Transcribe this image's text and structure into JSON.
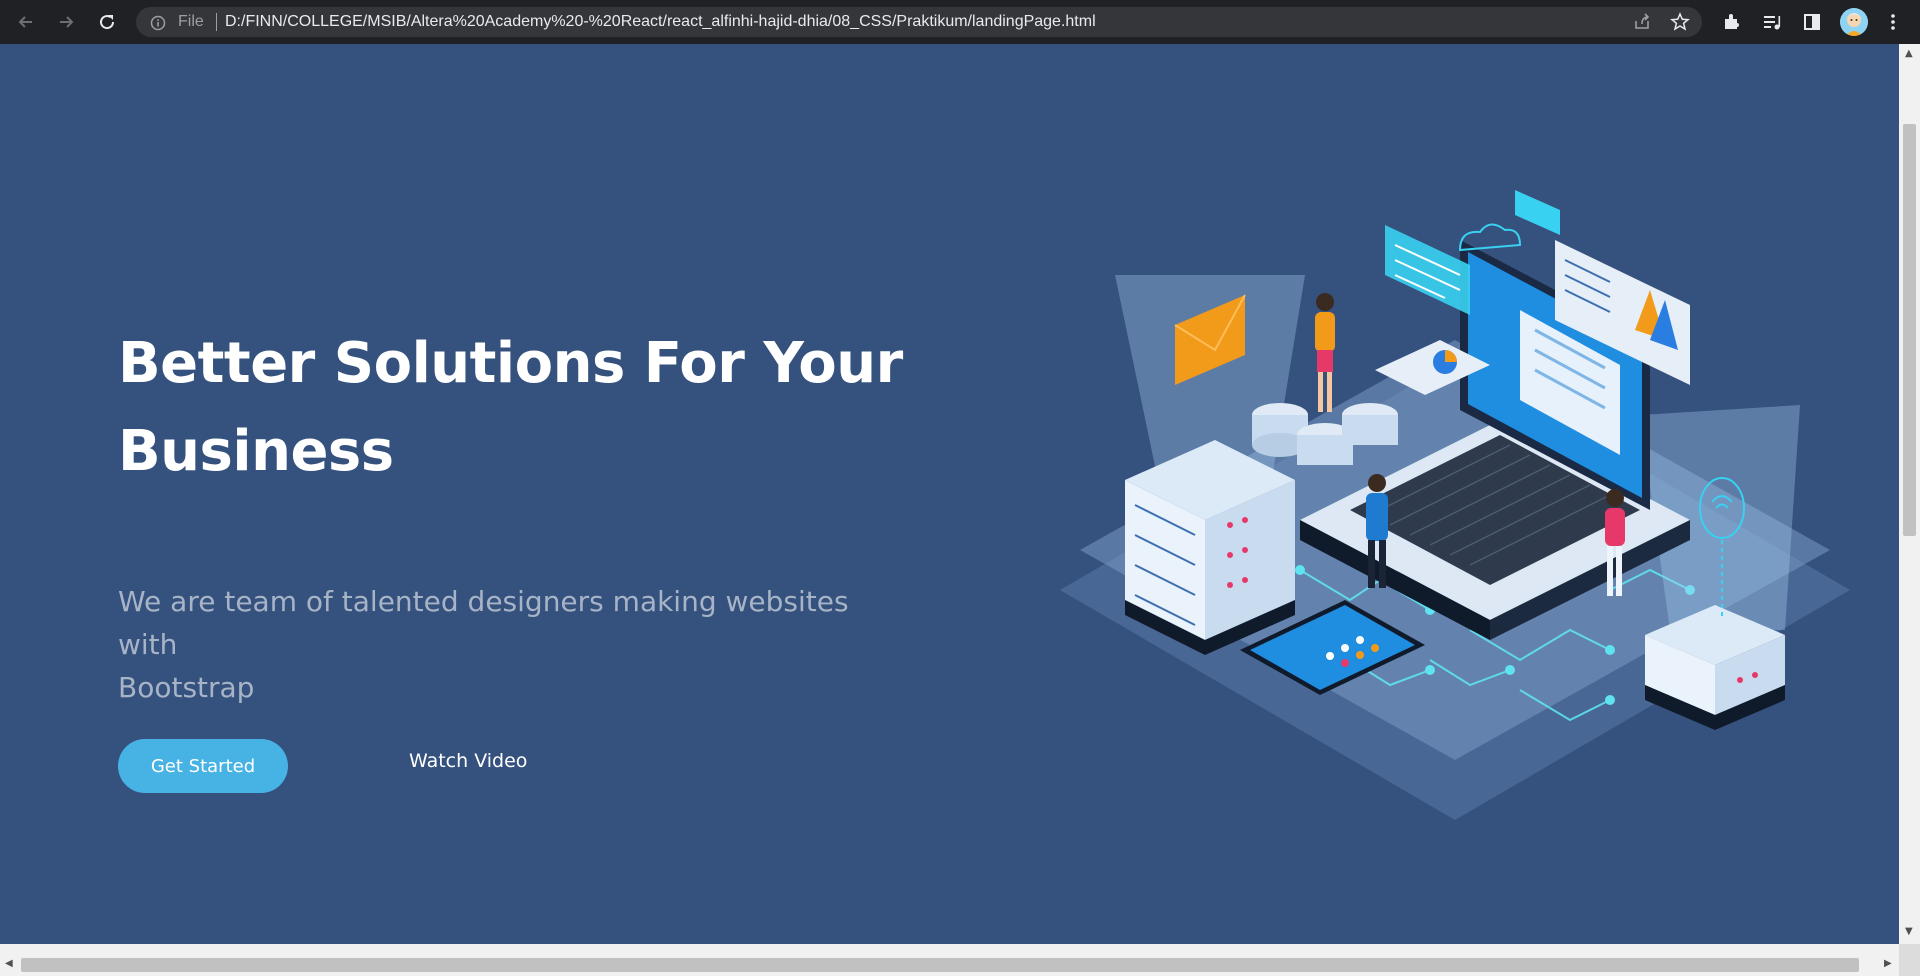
{
  "browser": {
    "file_label": "File",
    "url": "D:/FINN/COLLEGE/MSIB/Altera%20Academy%20-%20React/react_alfinhi-hajid-dhia/08_CSS/Praktikum/landingPage.html",
    "icons": [
      "back-arrow-icon",
      "forward-arrow-icon",
      "reload-icon",
      "info-icon",
      "share-icon",
      "star-icon",
      "extensions-icon",
      "media-control-icon",
      "side-panel-icon",
      "profile-avatar",
      "menu-kebab-icon"
    ]
  },
  "hero": {
    "title_line1": "Better Solutions For Your",
    "title_line2": "Business",
    "subtitle_line1": "We are team of talented designers making websites with",
    "subtitle_line2": "Bootstrap",
    "cta_label": "Get Started",
    "video_label": "Watch Video",
    "colors": {
      "background": "#35517e",
      "cta": "#47b2e4",
      "subtitle": "#a7b3c6"
    }
  }
}
